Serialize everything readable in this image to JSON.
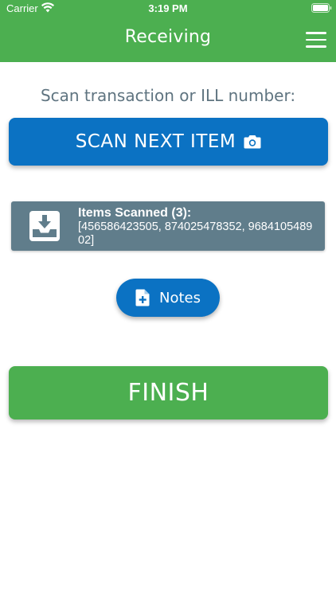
{
  "status_bar": {
    "carrier": "Carrier",
    "time": "3:19 PM",
    "icons": [
      "wifi-icon",
      "battery-icon"
    ]
  },
  "nav": {
    "title": "Receiving",
    "menu_icon": "menu-icon"
  },
  "prompt": "Scan transaction or ILL number:",
  "scan_button": {
    "label": "SCAN NEXT ITEM",
    "icon": "camera-icon"
  },
  "items_card": {
    "icon": "inbox-icon",
    "title": "Items Scanned (3):",
    "items_text": "[456586423505, 874025478352, 968410548902]"
  },
  "notes_button": {
    "label": "Notes",
    "icon": "note-add-icon"
  },
  "finish_button": {
    "label": "FINISH"
  },
  "colors": {
    "header_green": "#4caf50",
    "primary_blue": "#0b72c3",
    "card_slate": "#607d8b",
    "prompt_text": "#5f7480"
  }
}
